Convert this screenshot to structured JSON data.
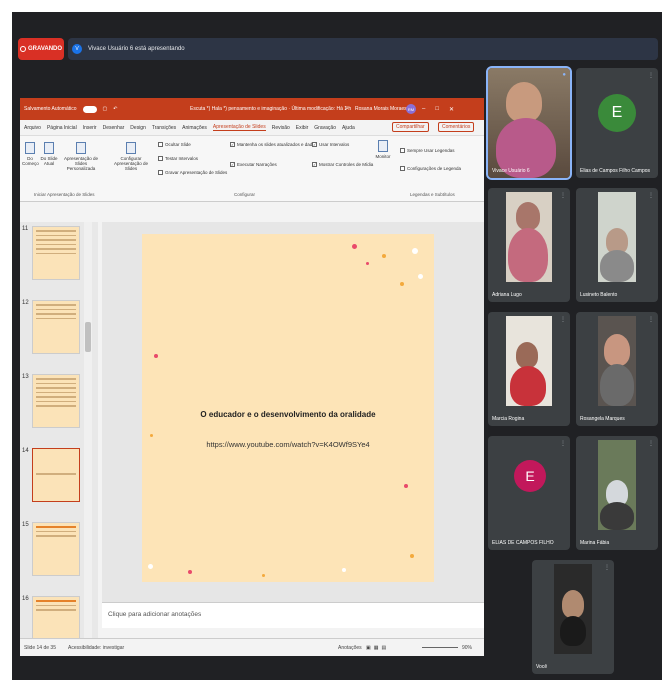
{
  "meet": {
    "recording_label": "GRAVANDO",
    "presenter_initial": "V",
    "presenting_text": "Vivace Usuário 6 está apresentando"
  },
  "ppt": {
    "autosave": "Salvamento Automático",
    "doc_title": "Escuta *) Hala *) pensamento e imaginação  ·  Última modificação: Há 1 h",
    "user": "Rosana Morais Moraes",
    "user_initials": "RM",
    "menu": [
      "Arquivo",
      "Página Inicial",
      "Inserir",
      "Desenhar",
      "Design",
      "Transições",
      "Animações",
      "Apresentação de Slides",
      "Revisão",
      "Exibir",
      "Gravação",
      "Ajuda"
    ],
    "active_menu": "Apresentação de Slides",
    "share": "Compartilhar",
    "comments": "Comentários",
    "ribbon": {
      "do_inicio": "Do Começo",
      "do_slide_atual": "Do Slide Atual",
      "personalizada": "Apresentação de Slides Personalizada",
      "group1": "Iniciar Apresentação de Slides",
      "configurar": "Configurar Apresentação de Slides",
      "ocultar": "Ocultar Slide",
      "testar": "Testar Intervalos",
      "gravar": "Gravar Apresentação de Slides",
      "manter": "Mantenha os slides atualizados e dados",
      "executar": "Executar Narrações",
      "usar_intervalos": "Usar Intervalos",
      "mostrar_controles": "Mostrar Controles de Mídia",
      "monitor": "Monitor",
      "group2": "Configurar",
      "sempre_legendas": "Sempre Usar Legendas",
      "config_legendas": "Configurações de Legenda",
      "group3": "Legendas e Subtítulos"
    },
    "thumb_numbers": [
      "11",
      "12",
      "13",
      "14",
      "15",
      "16"
    ],
    "slide_title": "O educador e o desenvolvimento da oralidade",
    "slide_link": "https://www.youtube.com/watch?v=K4OWf9SYe4",
    "notes_placeholder": "Clique para adicionar anotações",
    "status_slide": "Slide 14 de 35",
    "status_access": "Acessibilidade: investigar",
    "status_notes": "Anotações",
    "status_zoom": "90%"
  },
  "participants": [
    {
      "name": "Vivace Usuário 6"
    },
    {
      "name": "Elias de Campos Filho Campos",
      "initial": "E"
    },
    {
      "name": "Adriana Lugo"
    },
    {
      "name": "Lusineto Balento"
    },
    {
      "name": "Marcia Rogina"
    },
    {
      "name": "Rosangela Marques"
    },
    {
      "name": "ELIAS DE CAMPOS FILHO",
      "initial": "E"
    },
    {
      "name": "Marina Fábia"
    },
    {
      "name": "Você"
    }
  ],
  "colors": {
    "ppt_accent": "#c43e1c",
    "meet_bg": "#202124",
    "tile_bg": "#3c4043",
    "elias_green": "#3a8a3a",
    "elias_pink": "#c2185b"
  }
}
